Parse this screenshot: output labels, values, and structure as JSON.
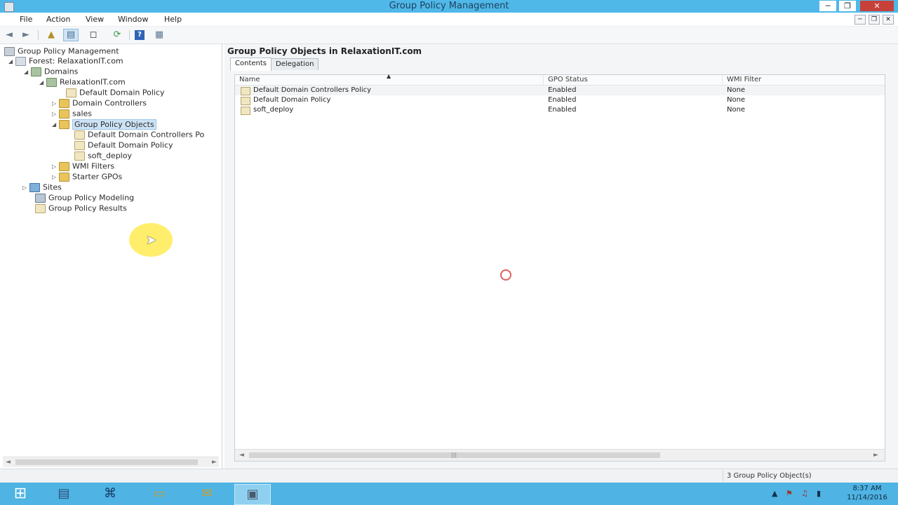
{
  "window": {
    "title": "Group Policy Management",
    "min_glyph": "─",
    "max_glyph": "❐",
    "close_glyph": "✕"
  },
  "menu": {
    "items": [
      "File",
      "Action",
      "View",
      "Window",
      "Help"
    ],
    "mdi_min": "─",
    "mdi_restore": "❐",
    "mdi_close": "✕"
  },
  "toolbar": {
    "back": "◄",
    "forward": "►",
    "up": "▲",
    "show_tree": "▤",
    "new_window": "◻",
    "refresh": "⟳",
    "help": "?",
    "properties": "▦"
  },
  "tree": {
    "root": "Group Policy Management",
    "forest": "Forest: RelaxationIT.com",
    "domains": "Domains",
    "domain": "RelaxationIT.com",
    "items": {
      "default_domain_policy": "Default Domain Policy",
      "domain_controllers": "Domain Controllers",
      "sales": "sales",
      "gpo_container": "Group Policy Objects",
      "gpo_ddcp": "Default Domain Controllers Po",
      "gpo_ddp": "Default Domain Policy",
      "gpo_soft": "soft_deploy",
      "wmi": "WMI Filters",
      "starter": "Starter GPOs"
    },
    "sites": "Sites",
    "modeling": "Group Policy Modeling",
    "results": "Group Policy Results",
    "scroll_left": "◄",
    "scroll_right": "►"
  },
  "details": {
    "header": "Group Policy Objects in RelaxationIT.com",
    "tabs": [
      "Contents",
      "Delegation"
    ],
    "columns": [
      "Name",
      "GPO Status",
      "WMI Filter"
    ],
    "rows": [
      {
        "name": "Default Domain Controllers Policy",
        "status": "Enabled",
        "wmi": "None"
      },
      {
        "name": "Default Domain Policy",
        "status": "Enabled",
        "wmi": "None"
      },
      {
        "name": "soft_deploy",
        "status": "Enabled",
        "wmi": "None"
      }
    ],
    "scroll_left": "◄",
    "scroll_right": "►",
    "scroll_grip": "|||"
  },
  "status": {
    "text": "3 Group Policy Object(s)"
  },
  "taskbar": {
    "start": "⊞",
    "apps": [
      "▤",
      "⌘",
      "▭",
      "✉",
      "▣"
    ],
    "tray": [
      "▲",
      "⚑",
      "♫",
      "▮"
    ],
    "time": "8:37 AM",
    "date": "11/14/2016"
  },
  "cursor": {
    "glyph": "➤"
  }
}
